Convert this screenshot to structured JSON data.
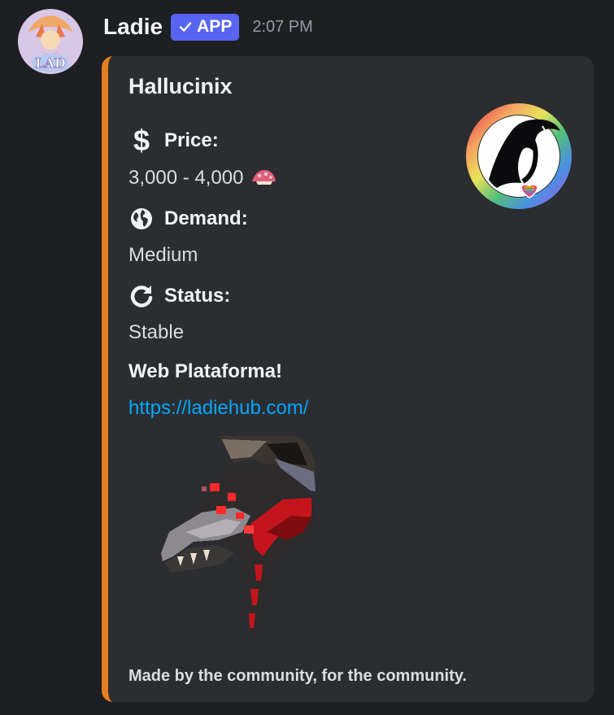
{
  "message": {
    "author": {
      "name": "Ladie",
      "badge": "APP",
      "avatar_icon": "community-avatar-image"
    },
    "timestamp": "2:07 PM"
  },
  "embed": {
    "accent_color": "#e67e22",
    "title": "Hallucinix",
    "thumbnail_icon": "pride-rainbow-ring-logo",
    "fields": {
      "price": {
        "icon": "dollar-sign-icon",
        "name": "Price:",
        "value": "3,000 - 4,000",
        "value_icon": "mushroom-icon"
      },
      "demand": {
        "icon": "globe-icon",
        "name": "Demand:",
        "value": "Medium"
      },
      "status": {
        "icon": "refresh-icon",
        "name": "Status:",
        "value": "Stable"
      },
      "web": {
        "name": "Web Plataforma!",
        "link": "https://ladiehub.com/"
      }
    },
    "image_icon": "creature-head-pixel-art",
    "footer": "Made by the community, for the community."
  },
  "colors": {
    "background": "#1e1f22",
    "embed_background": "#2b2d31",
    "badge": "#5865f2",
    "link": "#00a8fc"
  }
}
